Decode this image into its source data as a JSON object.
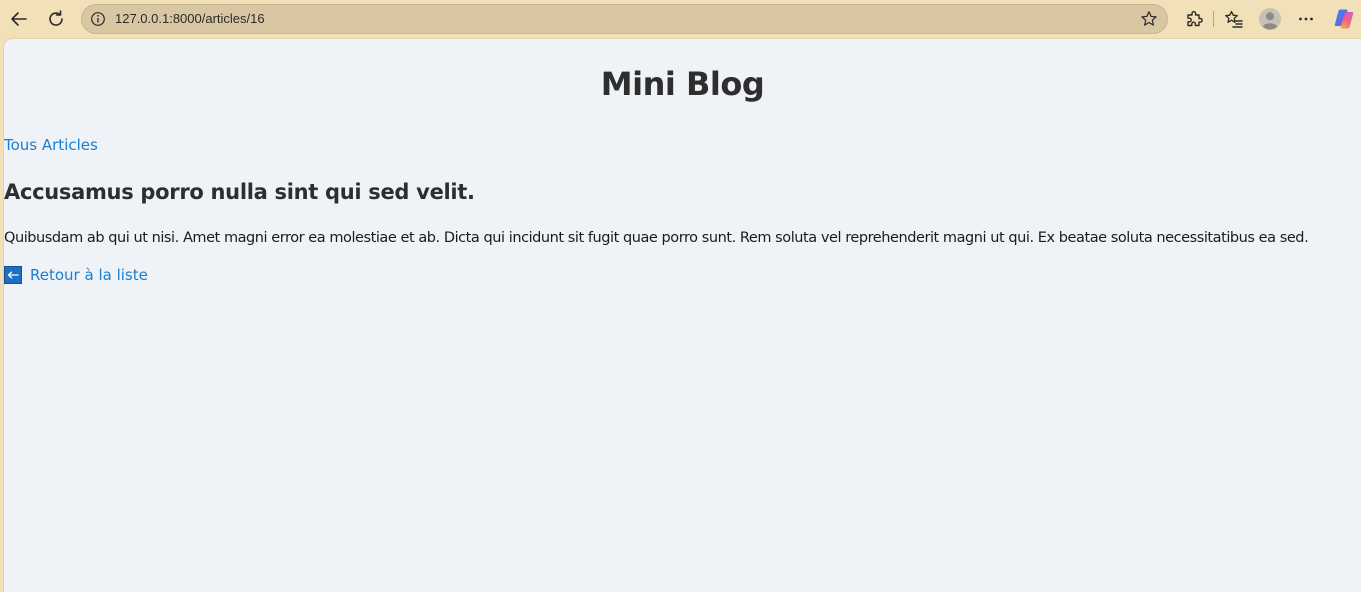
{
  "browser": {
    "url": "127.0.0.1:8000/articles/16",
    "icons": {
      "back": "back-arrow-icon",
      "reload": "reload-icon",
      "info": "info-icon",
      "favorite": "star-icon",
      "extensions": "puzzle-icon",
      "favorites": "favorites-list-icon",
      "profile": "profile-icon",
      "more": "more-dots-icon",
      "copilot": "copilot-icon"
    }
  },
  "page": {
    "site_title": "Mini Blog",
    "nav_link": "Tous Articles",
    "article": {
      "title": "Accusamus porro nulla sint qui sed velit.",
      "body": "Quibusdam ab qui ut nisi. Amet magni error ea molestiae et ab. Dicta qui incidunt sit fugit quae porro sunt. Rem soluta vel reprehenderit magni ut qui. Ex beatae soluta necessitatibus ea sed."
    },
    "back_link": {
      "icon": "left-arrow-icon",
      "label": "Retour à la liste"
    }
  },
  "colors": {
    "browser_frame": "#f2e1b8",
    "page_background": "#eff2f7",
    "link": "#1a7fd1",
    "heading": "#2e2e2e"
  }
}
